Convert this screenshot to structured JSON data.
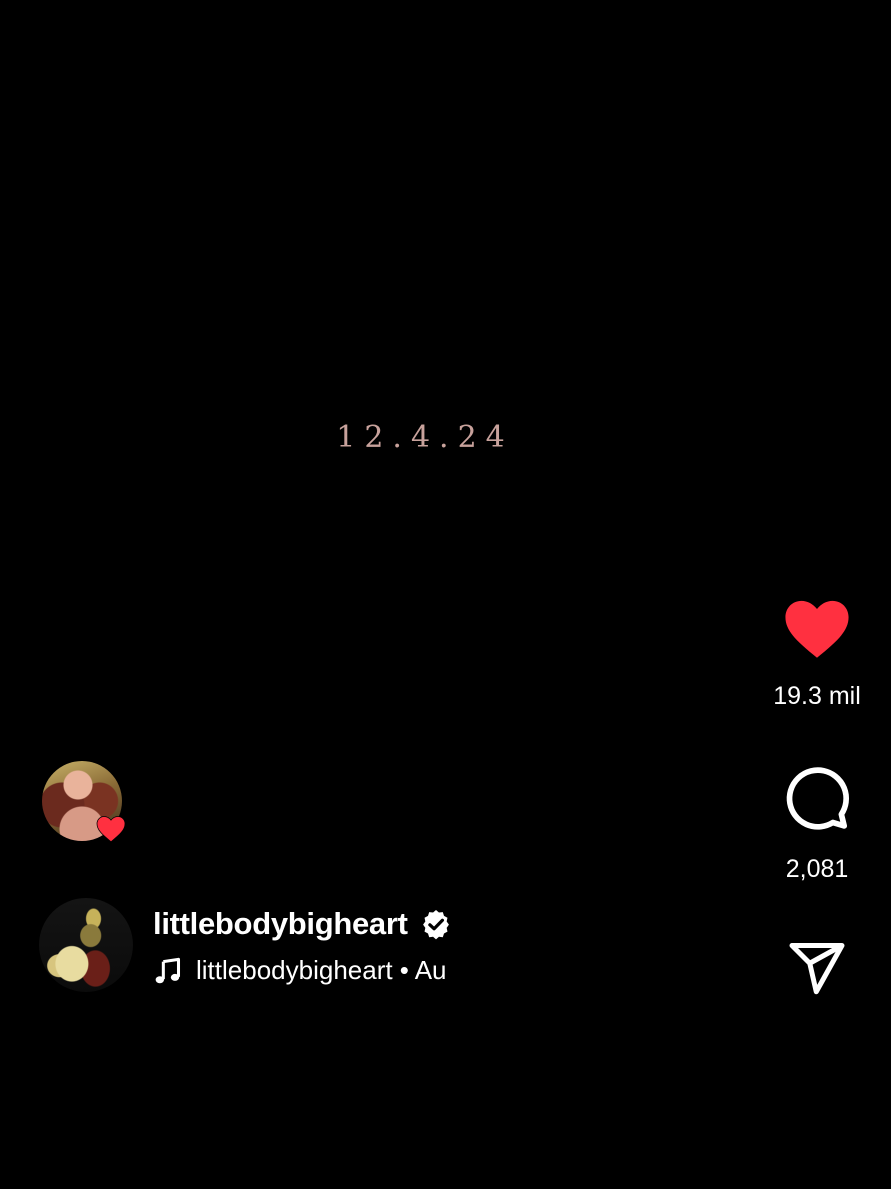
{
  "video": {
    "overlay_text": "12.4.24"
  },
  "actions": {
    "like": {
      "icon": "heart-icon",
      "count": "19.3 mil",
      "color": "#ff3040",
      "liked": true
    },
    "comment": {
      "icon": "comment-icon",
      "count": "2,081"
    },
    "share": {
      "icon": "send-icon"
    }
  },
  "liked_by": {
    "icon": "heart-icon",
    "color": "#ff3040"
  },
  "author": {
    "username": "littlebodybigheart",
    "verified": true,
    "verified_icon": "verified-badge-icon"
  },
  "audio": {
    "icon": "music-note-icon",
    "text": "littlebodybigheart • Au"
  }
}
